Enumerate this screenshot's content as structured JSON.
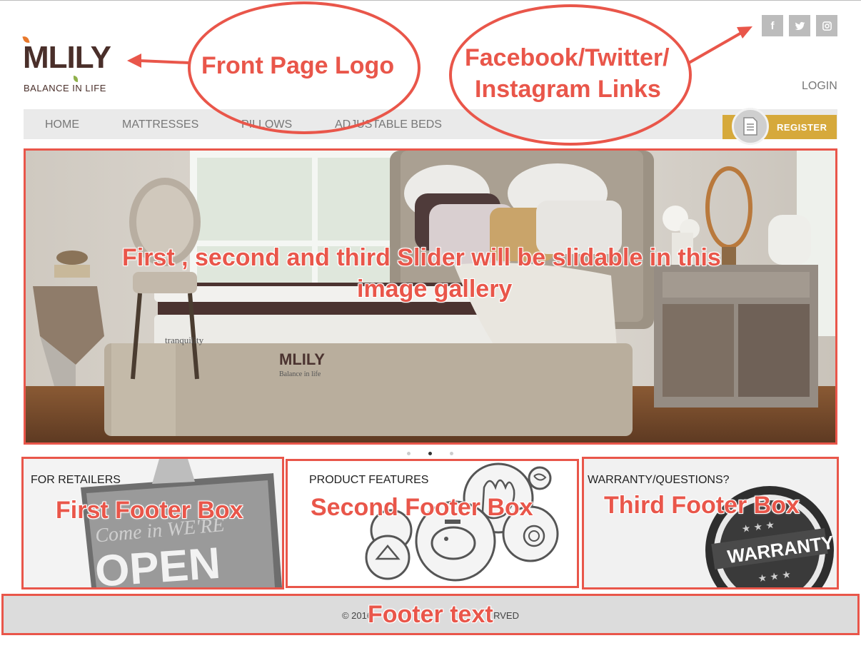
{
  "brand": {
    "logo_word": "MLILY",
    "tagline": "BALANCE IN LIFE"
  },
  "social": [
    {
      "icon": "facebook-icon",
      "glyph": "f"
    },
    {
      "icon": "twitter-icon",
      "glyph": ""
    },
    {
      "icon": "instagram-icon",
      "glyph": ""
    }
  ],
  "header": {
    "login_label": "LOGIN",
    "register_label": "REGISTER"
  },
  "nav": {
    "items": [
      "HOME",
      "MATTRESSES",
      "PILLOWS",
      "ADJUSTABLE BEDS"
    ]
  },
  "slider": {
    "mattress_brand": "tranquility",
    "mattress_logo": "MLILY",
    "mattress_tagline": "Balance in life",
    "slides_total": 3,
    "active_slide": 2
  },
  "footer_boxes": [
    {
      "title": "FOR RETAILERS",
      "sign_top": "Come in WE'RE",
      "sign_main": "OPEN"
    },
    {
      "title": "PRODUCT FEATURES"
    },
    {
      "title": "WARRANTY/QUESTIONS?",
      "badge_text": "WARRANTY"
    }
  ],
  "footer": {
    "text_left": "© 2016",
    "text_right": "RVED"
  },
  "annotations": {
    "logo": "Front Page Logo",
    "social_line1": "Facebook/Twitter/",
    "social_line2": "Instagram Links",
    "slider_line1": "First , second and third Slider will be slidable in this",
    "slider_line2": "image gallery",
    "box1": "First Footer Box",
    "box2": "Second Footer Box",
    "box3": "Third Footer Box",
    "footer": "Footer text"
  },
  "colors": {
    "annotation_red": "#e9564a",
    "brand_brown": "#4a2f2a",
    "register_gold": "#d6a93b",
    "nav_bg": "#eaeaea",
    "social_grey": "#bcbcbc"
  }
}
